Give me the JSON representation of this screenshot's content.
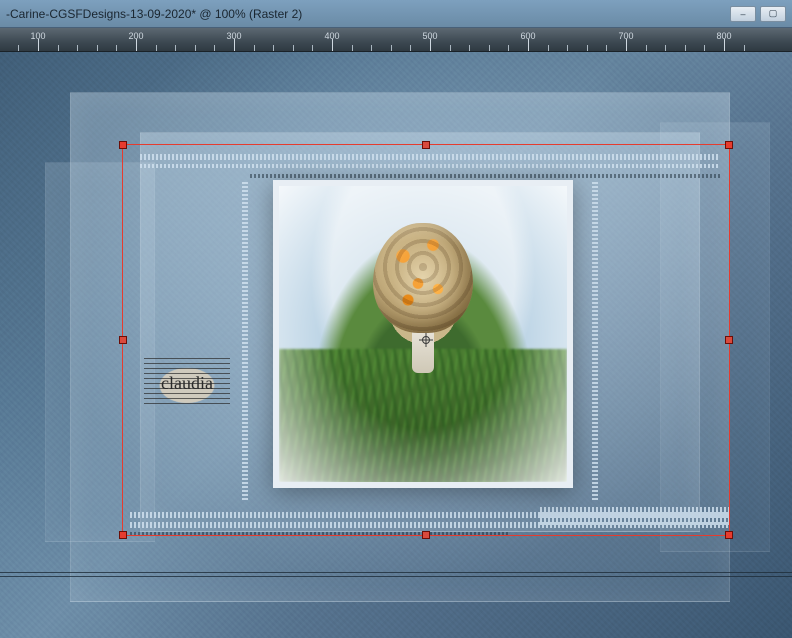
{
  "window": {
    "title_fragment": "-Carine-CGSFDesigns-13-09-2020* @ 100% (Raster 2)",
    "min_label": "–",
    "max_label": "▢"
  },
  "ruler": {
    "labels": [
      "100",
      "200",
      "300",
      "400",
      "500",
      "600",
      "700",
      "800"
    ]
  },
  "watermark": {
    "text": "claudia"
  },
  "selection": {
    "layer_name": "Raster 2"
  }
}
